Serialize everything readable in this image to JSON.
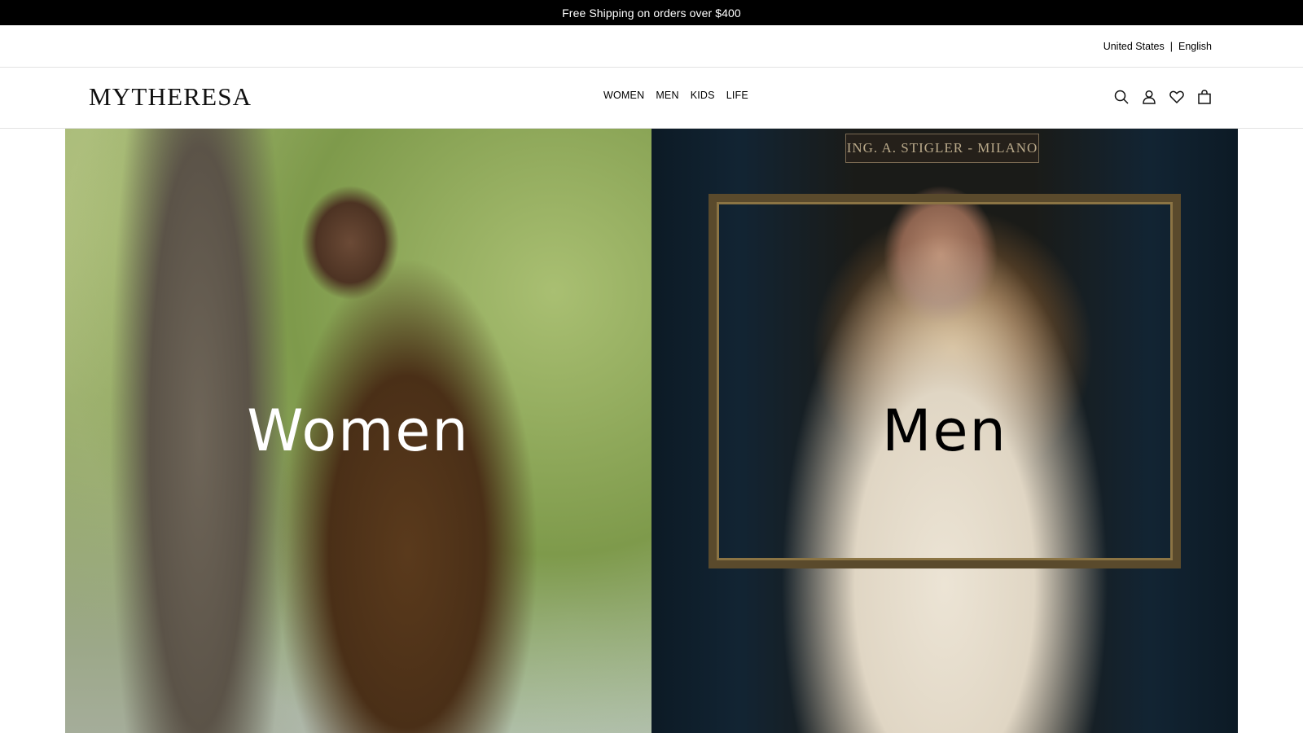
{
  "promo": {
    "text": "Free Shipping on orders over $400"
  },
  "locale": {
    "country": "United States",
    "separator": "|",
    "language": "English"
  },
  "header": {
    "logo": "MYTHERESA",
    "nav": [
      "WOMEN",
      "MEN",
      "KIDS",
      "LIFE"
    ],
    "icons": [
      "search-icon",
      "account-icon",
      "wishlist-icon",
      "bag-icon"
    ]
  },
  "hero": {
    "tiles": [
      {
        "title": "Women"
      },
      {
        "title": "Men",
        "sign": "ING. A. STIGLER - MILANO"
      }
    ]
  },
  "colors": {
    "promo_bg": "#000000",
    "promo_text": "#ffffff",
    "divider": "#e2e2e2"
  }
}
